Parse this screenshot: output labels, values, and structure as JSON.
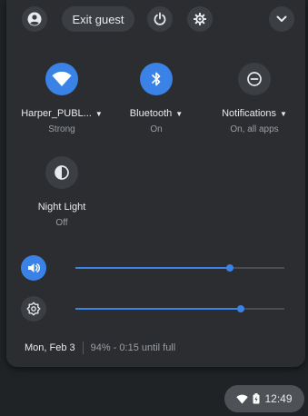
{
  "top_bar": {
    "exit_guest_label": "Exit guest",
    "icons": [
      "account-icon",
      "power-icon",
      "settings-icon",
      "collapse-icon"
    ]
  },
  "tiles": [
    {
      "icon": "wifi-icon",
      "label": "Harper_PUBL...",
      "sublabel": "Strong",
      "active": true
    },
    {
      "icon": "bluetooth-icon",
      "label": "Bluetooth",
      "sublabel": "On",
      "active": true
    },
    {
      "icon": "notifications-icon",
      "label": "Notifications",
      "sublabel": "On, all apps",
      "active": false
    },
    {
      "icon": "night-light-icon",
      "label": "Night Light",
      "sublabel": "Off",
      "active": false
    }
  ],
  "sliders": {
    "volume": {
      "icon": "volume-icon",
      "level": 0.74,
      "active": true
    },
    "brightness": {
      "icon": "brightness-icon",
      "level": 0.79,
      "active": false
    }
  },
  "status": {
    "date": "Mon, Feb 3",
    "battery": "94% - 0:15 until full"
  },
  "shelf": {
    "time": "12:49",
    "icons": [
      "wifi-status-icon",
      "battery-icon"
    ]
  },
  "colors": {
    "accent": "#3b82e6",
    "panel": "#2b2d30",
    "button": "#3b3e42",
    "text": "#e8eaed",
    "subtext": "#9aa0a6"
  }
}
